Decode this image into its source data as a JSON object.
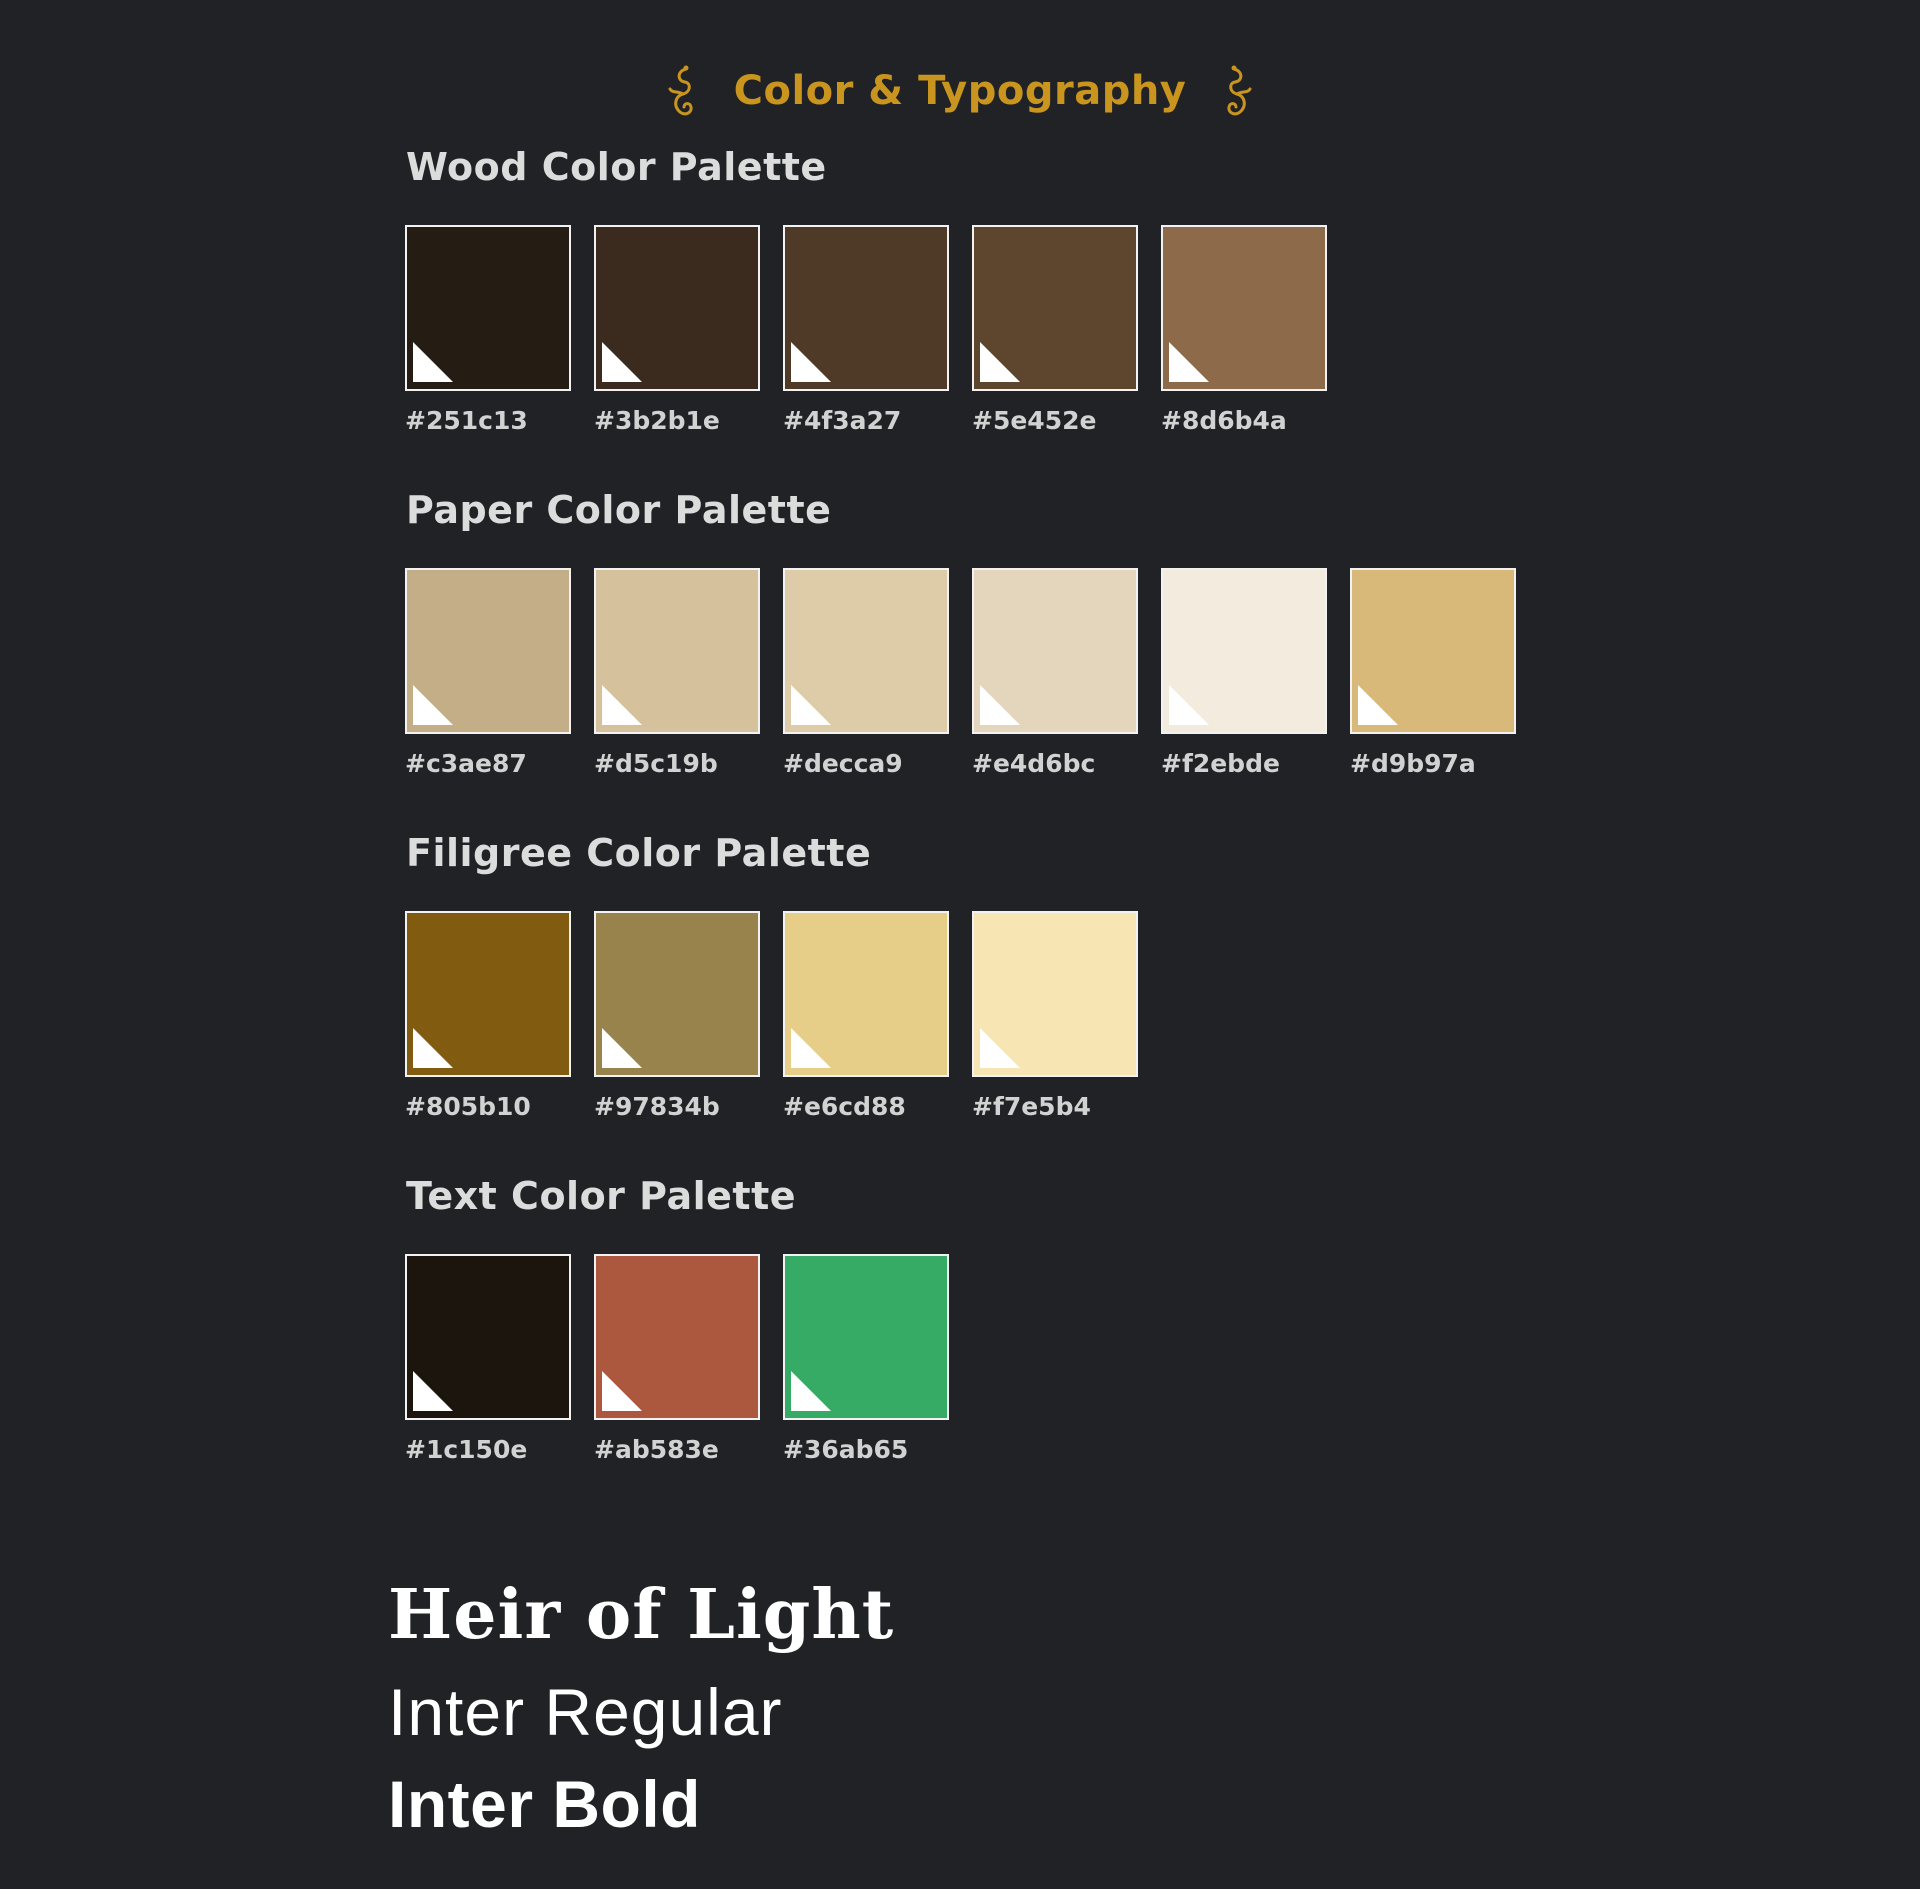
{
  "header": {
    "title": "Color & Typography",
    "left_icon": "filigree-flourish-icon",
    "right_icon": "filigree-flourish-icon",
    "title_color": "#c9951f"
  },
  "palettes": [
    {
      "title": "Wood Color Palette",
      "swatches": [
        {
          "hex": "#251c13",
          "label": "#251c13"
        },
        {
          "hex": "#3b2b1e",
          "label": "#3b2b1e"
        },
        {
          "hex": "#4f3a27",
          "label": "#4f3a27"
        },
        {
          "hex": "#5e452e",
          "label": "#5e452e"
        },
        {
          "hex": "#8d6b4a",
          "label": "#8d6b4a"
        }
      ]
    },
    {
      "title": "Paper Color Palette",
      "swatches": [
        {
          "hex": "#c3ae87",
          "label": "#c3ae87"
        },
        {
          "hex": "#d5c19b",
          "label": "#d5c19b"
        },
        {
          "hex": "#decca9",
          "label": "#decca9"
        },
        {
          "hex": "#e4d6bc",
          "label": "#e4d6bc"
        },
        {
          "hex": "#f2ebde",
          "label": "#f2ebde"
        },
        {
          "hex": "#d9b97a",
          "label": "#d9b97a"
        }
      ]
    },
    {
      "title": "Filigree Color Palette",
      "swatches": [
        {
          "hex": "#805b10",
          "label": "#805b10"
        },
        {
          "hex": "#97834b",
          "label": "#97834b"
        },
        {
          "hex": "#e6cd88",
          "label": "#e6cd88"
        },
        {
          "hex": "#f7e5b4",
          "label": "#f7e5b4"
        }
      ]
    },
    {
      "title": "Text Color Palette",
      "swatches": [
        {
          "hex": "#1c150e",
          "label": "#1c150e"
        },
        {
          "hex": "#ab583e",
          "label": "#ab583e"
        },
        {
          "hex": "#36ab65",
          "label": "#36ab65"
        }
      ]
    }
  ],
  "typography": {
    "serif_sample": "Heir of Light",
    "regular_sample": "Inter Regular",
    "bold_sample": "Inter Bold"
  },
  "colors": {
    "background": "#202226",
    "swatch_border": "#f2f2f2",
    "label_text": "#d2d2d2"
  }
}
